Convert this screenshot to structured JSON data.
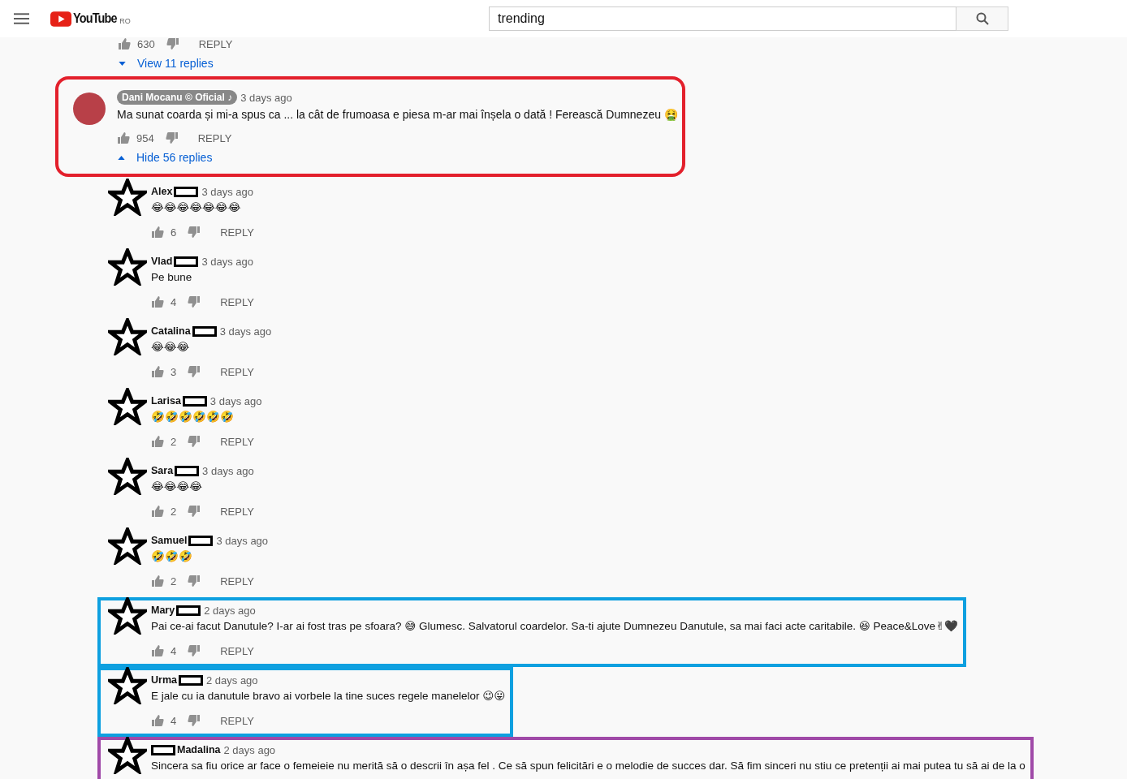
{
  "header": {
    "logo": "YouTube",
    "region": "RO",
    "search": {
      "value": "trending"
    }
  },
  "previous_comment": {
    "likes": "630",
    "reply": "REPLY",
    "toggle": {
      "label": "View 11 replies",
      "expanded": false
    }
  },
  "comment": {
    "author": "Dani Mocanu © Oficial ♪",
    "owner": true,
    "time": "3 days ago",
    "text": "Ma sunat coarda și mi-a spus ca ... la cât de frumoasa e piesa m-ar mai înșela o dată ! Ferească Dumnezeu 🤮",
    "likes": "954",
    "reply": "REPLY",
    "color": "#e3202c",
    "toggle": {
      "label": "Hide 56 replies",
      "expanded": true
    }
  },
  "replies": [
    {
      "author": "Alex",
      "redacted": true,
      "redaction_first": false,
      "time": "3 days ago",
      "text": "😂😂😂😂😂😂😂",
      "likes": "6",
      "reply": "REPLY"
    },
    {
      "author": "Vlad",
      "redacted": true,
      "redaction_first": false,
      "time": "3 days ago",
      "text": "Pe bune",
      "likes": "4",
      "reply": "REPLY"
    },
    {
      "author": "Catalina",
      "redacted": true,
      "redaction_first": false,
      "time": "3 days ago",
      "text": "😂😂😂",
      "likes": "3",
      "reply": "REPLY"
    },
    {
      "author": "Larisa",
      "redacted": true,
      "redaction_first": false,
      "time": "3 days ago",
      "text": "🤣🤣🤣🤣🤣🤣",
      "likes": "2",
      "reply": "REPLY"
    },
    {
      "author": "Sara",
      "redacted": true,
      "redaction_first": false,
      "time": "3 days ago",
      "text": "😂😂😂😂",
      "likes": "2",
      "reply": "REPLY"
    },
    {
      "author": "Samuel",
      "redacted": true,
      "redaction_first": false,
      "time": "3 days ago",
      "text": "🤣🤣🤣",
      "likes": "2",
      "reply": "REPLY"
    },
    {
      "author": "Mary",
      "redacted": true,
      "redaction_first": false,
      "time": "2 days ago",
      "text": "Pai ce-ai facut Danutule? I-ar ai fost tras pe sfoara? 😅 Glumesc. Salvatorul coardelor. Sa-ti ajute Dumnezeu Danutule, sa mai faci acte caritabile. 😆 Peace&Love✌🖤",
      "likes": "4",
      "reply": "REPLY",
      "color": "#0ea0e0"
    },
    {
      "author": "Urma",
      "redacted": true,
      "redaction_first": false,
      "time": "2 days ago",
      "text": "E jale cu ia danutule bravo ai vorbele la tine suces regele manelelor 😉😛",
      "likes": "4",
      "reply": "REPLY",
      "color": "#0ea0e0"
    },
    {
      "author": "Madalina",
      "redacted": true,
      "redaction_first": true,
      "time": "2 days ago",
      "text": "Sincera sa fiu orice ar face o femeieie nu merită să o descrii în așa fel . Ce să spun felicitări e o melodie de succes dar. Să fim sinceri nu stiu ce pretenții ai mai putea tu să ai de la o",
      "color": "#a04aa8"
    }
  ]
}
